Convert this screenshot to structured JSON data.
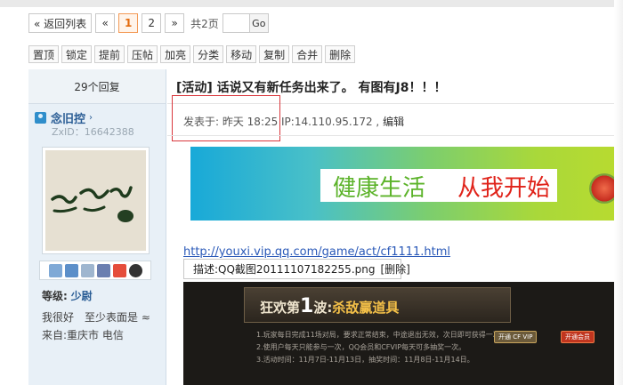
{
  "pager": {
    "back_label": "« 返回列表",
    "prev_label": "«",
    "pages": [
      "1",
      "2"
    ],
    "next_label": "»",
    "total_label": "共2页",
    "go_label": "Go"
  },
  "modbar": {
    "buttons": [
      "置顶",
      "锁定",
      "提前",
      "压帖",
      "加亮",
      "分类",
      "移动",
      "复制",
      "合并",
      "删除"
    ]
  },
  "post": {
    "reply_count": "29个回复",
    "title": "[活动] 话说又有新任务出来了。 有图有J8！！！",
    "time": "发表于: 昨天 18:25",
    "ip": "IP:14.110.95.172 ,",
    "edit_label": "编辑",
    "banner_text_1": "健康生活",
    "banner_text_2": "从我开始",
    "link": "http://youxi.vip.qq.com/game/act/cf1111.html",
    "caption": "描述:QQ截图20111107182255.png",
    "caption_delete": "[删除]",
    "game": {
      "headline_prefix": "狂欢第",
      "headline_num": "1",
      "headline_mid": "波:",
      "headline_hl": "杀敌赢道具",
      "lines": [
        "1.玩家每日完成11场对局，要求正常结束，中途退出无效，次日即可获得一次抽奖机会。",
        "2.使用户每天只能参与一次，QQ会员和CFVIP每天可多抽奖一次。",
        "3.活动时间：11月7日-11月13日，抽奖时间：11月8日-11月14日。"
      ],
      "btn_a": "开通 CF VIP",
      "btn_b": "开通会员"
    }
  },
  "user": {
    "name": "念旧控",
    "arrow": "›",
    "id": "ZxID：16642388",
    "level_label": "等级:",
    "level": "少尉",
    "signature": "我很好　至少表面是 ≈",
    "from": "来自:重庆市 电信"
  }
}
